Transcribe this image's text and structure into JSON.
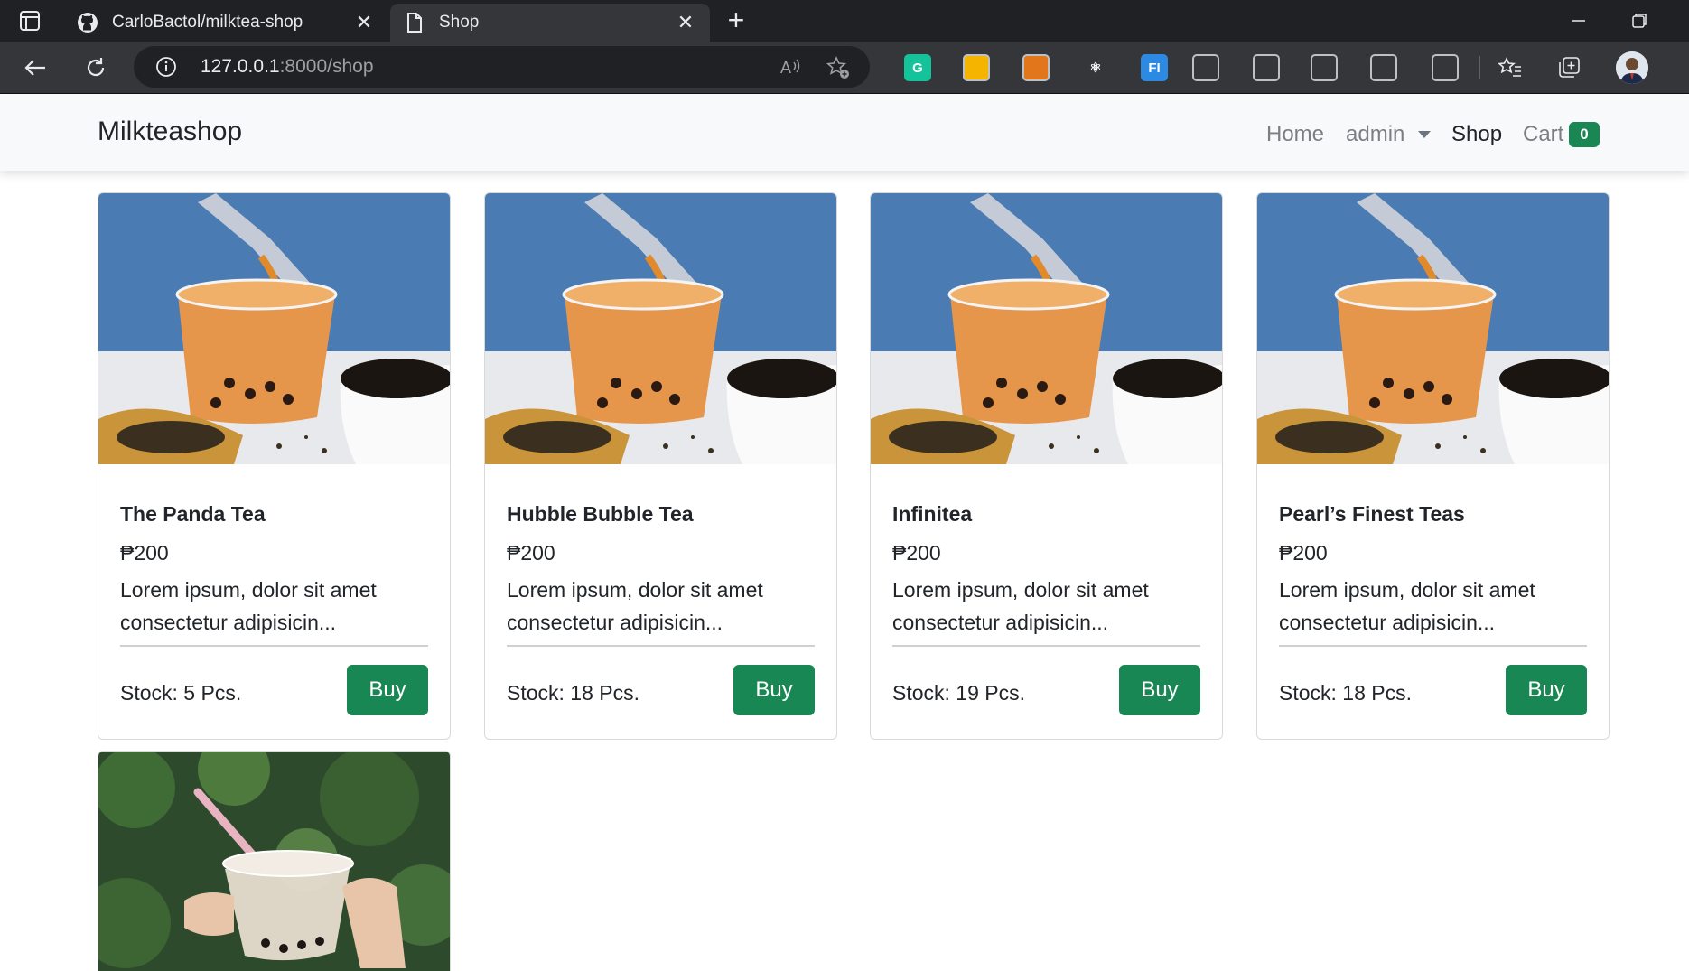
{
  "browser": {
    "tabs": [
      {
        "title": "CarloBactol/milktea-shop",
        "icon": "github-icon"
      },
      {
        "title": "Shop",
        "icon": "document-icon"
      }
    ],
    "url_host": "127.0.0.1",
    "url_rest": ":8000/shop",
    "extensions": [
      {
        "name": "grammarly-extension-icon",
        "label": "G",
        "color": "#15c39a"
      },
      {
        "name": "color-extension-icon",
        "label": "",
        "color": "#f5b400"
      },
      {
        "name": "metamask-extension-icon",
        "label": "",
        "color": "#e2761b"
      },
      {
        "name": "react-devtools-icon",
        "label": "⚛",
        "color": "#35363a"
      },
      {
        "name": "fi-extension-icon",
        "label": "FI",
        "color": "#2d8ae2"
      },
      {
        "name": "ruler-extension-icon",
        "label": "",
        "color": "#35363a"
      },
      {
        "name": "clock-extension-icon",
        "label": "",
        "color": "#35363a"
      },
      {
        "name": "copy-extension-icon",
        "label": "",
        "color": "#35363a"
      },
      {
        "name": "qr-extension-icon",
        "label": "",
        "color": "#35363a"
      },
      {
        "name": "puzzle-extension-icon",
        "label": "",
        "color": "#35363a"
      }
    ]
  },
  "navbar": {
    "brand": "Milkteashop",
    "links": {
      "home": "Home",
      "user": "admin",
      "shop": "Shop",
      "cart": "Cart"
    },
    "cart_count": "0"
  },
  "products": [
    {
      "name": "The Panda Tea",
      "price": "₱200",
      "description": "Lorem ipsum, dolor sit amet consectetur adipisicin...",
      "stock": "Stock: 5 Pcs.",
      "button": "Buy"
    },
    {
      "name": "Hubble Bubble Tea",
      "price": "₱200",
      "description": "Lorem ipsum, dolor sit amet consectetur adipisicin...",
      "stock": "Stock: 18 Pcs.",
      "button": "Buy"
    },
    {
      "name": "Infinitea",
      "price": "₱200",
      "description": "Lorem ipsum, dolor sit amet consectetur adipisicin...",
      "stock": "Stock: 19 Pcs.",
      "button": "Buy"
    },
    {
      "name": "Pearl’s Finest Teas",
      "price": "₱200",
      "description": "Lorem ipsum, dolor sit amet consectetur adipisicin...",
      "stock": "Stock: 18 Pcs.",
      "button": "Buy"
    }
  ],
  "colors": {
    "accent": "#198754",
    "chrome_dark": "#202124",
    "navbar_bg": "#f8f9fa"
  }
}
